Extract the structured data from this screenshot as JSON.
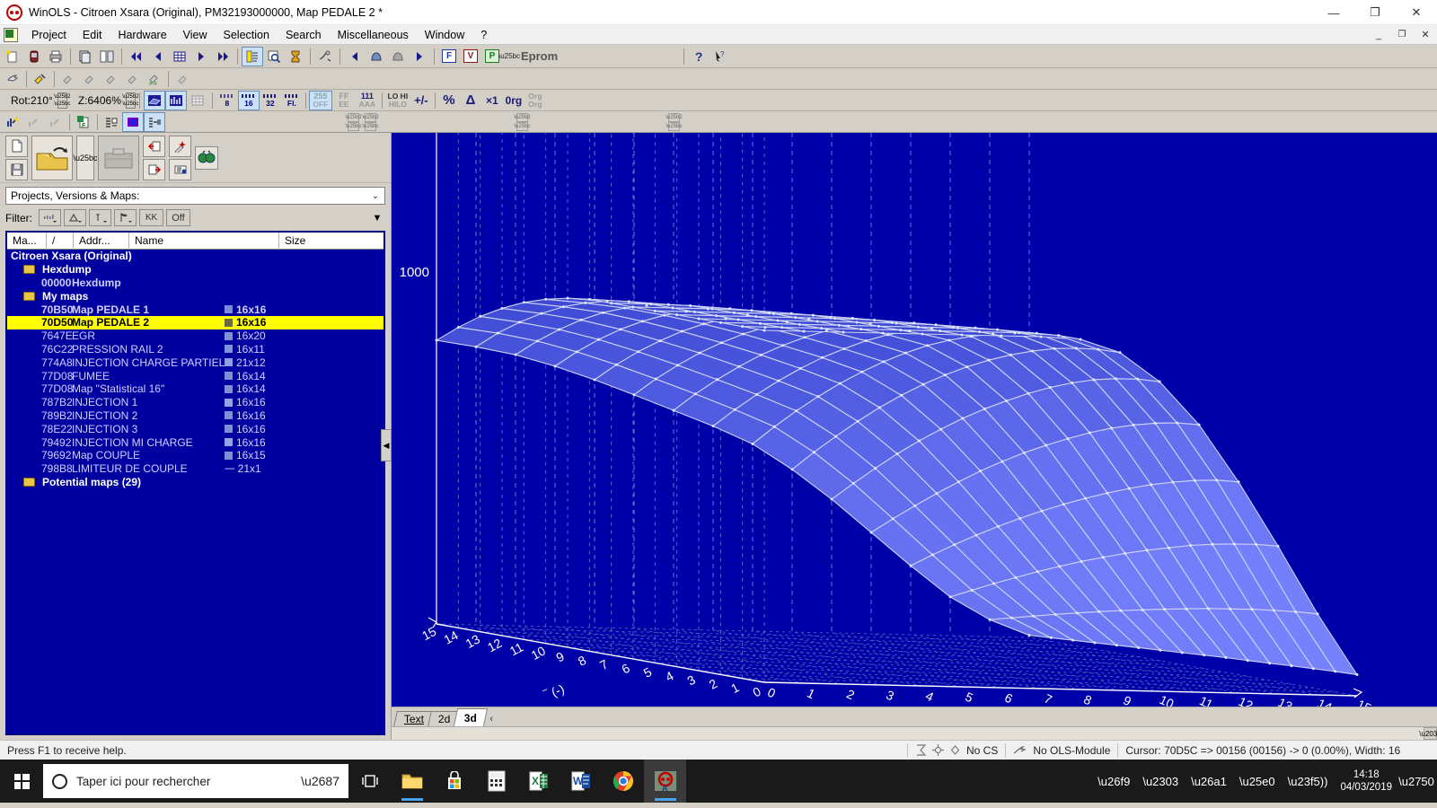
{
  "window": {
    "title": "WinOLS - Citroen Xsara (Original), PM32193000000, Map PEDALE 2 *",
    "minimize": "—",
    "maximize": "❐",
    "close": "✕",
    "inner_minimize": "_",
    "inner_restore": "❐",
    "inner_close": "✕"
  },
  "menu": {
    "items": [
      {
        "label": "Project"
      },
      {
        "label": "Edit"
      },
      {
        "label": "Hardware"
      },
      {
        "label": "View"
      },
      {
        "label": "Selection"
      },
      {
        "label": "Search"
      },
      {
        "label": "Miscellaneous"
      },
      {
        "label": "Window"
      },
      {
        "label": "?"
      }
    ]
  },
  "toolbar_main": {
    "eprom_label": "Eprom",
    "mode_f": "F",
    "mode_v": "V",
    "mode_p": "P",
    "help": "?",
    "help_arrow": "❇"
  },
  "toolbar_view": {
    "rotation": "Rot:210°",
    "zoom": "Z:6406%",
    "bits": [
      "8",
      "16",
      "32",
      "Fl."
    ],
    "bits_selected": "16",
    "values": [
      "255",
      "FF",
      "111"
    ],
    "values_sub": [
      "OFF",
      "EE",
      "AAA"
    ],
    "values_selected": "255",
    "hilo_top": "LO HI",
    "hilo_bottom": "HILO",
    "plusminus": "+/-",
    "percent": "%",
    "delta": "Δ",
    "times1": "×1",
    "org": "0rg",
    "orgorg_top": "Org",
    "orgorg_bottom": "Org"
  },
  "left_panel": {
    "combo": {
      "value": "Projects, Versions & Maps:",
      "chevron": "⌄"
    },
    "filter": {
      "label": "Filter:",
      "buttons": [
        "▒",
        "Δ",
        "i̅",
        "⚑",
        "KK"
      ],
      "off_label": "Off",
      "dropdown": "▼"
    },
    "columns": [
      "Ma...",
      "/",
      "Addr...",
      "Name",
      "Size"
    ],
    "rows": [
      {
        "type": "root",
        "name": "Citroen Xsara (Original)"
      },
      {
        "type": "folder",
        "name": "Hexdump"
      },
      {
        "type": "item",
        "addr": "00000",
        "name": "Hexdump",
        "size": "",
        "bold": true,
        "chip": ""
      },
      {
        "type": "folder",
        "name": "My maps"
      },
      {
        "type": "item",
        "addr": "70B50",
        "name": "Map PEDALE 1",
        "size": "16x16",
        "bold": true,
        "chip": "#7a8ce0"
      },
      {
        "type": "item",
        "addr": "70D50",
        "name": "Map PEDALE 2",
        "size": "16x16",
        "bold": true,
        "highlight": true,
        "chip": "#6a6a3a"
      },
      {
        "type": "item",
        "addr": "7647E",
        "name": "EGR",
        "size": "16x20",
        "chip": "#8090d8"
      },
      {
        "type": "item",
        "addr": "76C22",
        "name": "PRESSION RAIL 2",
        "size": "16x11",
        "chip": "#7f93dd"
      },
      {
        "type": "item",
        "addr": "774A8",
        "name": "INJECTION CHARGE PARTIEL1",
        "size": "21x12",
        "chip": "#8fa0e4"
      },
      {
        "type": "item",
        "addr": "77D08",
        "name": "FUMEE",
        "size": "16x14",
        "chip": "#8090d8"
      },
      {
        "type": "item",
        "addr": "77D08",
        "name": "Map \"Statistical 16\"",
        "size": "16x14",
        "chip": "#8090d8"
      },
      {
        "type": "item",
        "addr": "787B2",
        "name": "INJECTION 1",
        "size": "16x16",
        "chip": "#93a3e8"
      },
      {
        "type": "item",
        "addr": "789B2",
        "name": "INJECTION 2",
        "size": "16x16",
        "chip": "#8090d8"
      },
      {
        "type": "item",
        "addr": "78E22",
        "name": "INJECTION 3",
        "size": "16x16",
        "chip": "#8090d8"
      },
      {
        "type": "item",
        "addr": "79492",
        "name": "INJECTION MI CHARGE",
        "size": "16x16",
        "chip": "#93a3e8"
      },
      {
        "type": "item",
        "addr": "79692",
        "name": "Map COUPLE",
        "size": "16x15",
        "chip": "#8090d8"
      },
      {
        "type": "item",
        "addr": "798B8",
        "name": "LIMITEUR DE COUPLE",
        "size": "21x1",
        "chip": "dashes"
      },
      {
        "type": "folder",
        "name": "Potential maps (29)"
      }
    ],
    "splitter": "◀"
  },
  "view_tabs": {
    "items": [
      {
        "label": "Text",
        "active": false
      },
      {
        "label": "2d",
        "active": false
      },
      {
        "label": "3d",
        "active": true
      }
    ],
    "scroll_left": "‹"
  },
  "statusbar": {
    "hint": "Press F1 to receive help.",
    "checksum": "No CS",
    "module": "No OLS-Module",
    "cursor": "Cursor: 70D5C => 00156 (00156) -> 0 (0.00%), Width: 16"
  },
  "taskbar": {
    "search_placeholder": "Taper ici pour rechercher",
    "time": "14:18",
    "date": "04/03/2019",
    "apps": [
      {
        "name": "task-view"
      },
      {
        "name": "file-explorer"
      },
      {
        "name": "microsoft-store"
      },
      {
        "name": "calculator"
      },
      {
        "name": "excel"
      },
      {
        "name": "word"
      },
      {
        "name": "chrome"
      },
      {
        "name": "winols",
        "active": true
      }
    ]
  },
  "chart_data": {
    "type": "surface",
    "title": "Map PEDALE 2",
    "xlabel": "(-)",
    "ylabel": "(-)",
    "zlabel": "1000",
    "x_ticks": [
      0,
      1,
      2,
      3,
      4,
      5,
      6,
      7,
      8,
      9,
      10,
      11,
      12,
      13,
      14,
      15
    ],
    "y_ticks": [
      0,
      1,
      2,
      3,
      4,
      5,
      6,
      7,
      8,
      9,
      10,
      11,
      12,
      13,
      14,
      15
    ],
    "z_ticks": [
      1000
    ],
    "grid": true,
    "rotation_deg": 210,
    "zoom_percent": 6406,
    "rows": 16,
    "cols": 16,
    "surface_color": "#4a57cf",
    "background_color": "#0000a8",
    "mesh_color": "#ccd2f5",
    "values": [
      [
        1000,
        1000,
        1000,
        1000,
        1000,
        1000,
        1000,
        1000,
        995,
        960,
        880,
        760,
        600,
        420,
        230,
        60
      ],
      [
        1000,
        1000,
        1000,
        1000,
        1000,
        1000,
        1000,
        1000,
        995,
        958,
        876,
        754,
        594,
        414,
        225,
        58
      ],
      [
        1000,
        1000,
        1000,
        1000,
        1000,
        1000,
        1000,
        998,
        990,
        950,
        866,
        742,
        582,
        404,
        218,
        55
      ],
      [
        1000,
        1000,
        1000,
        1000,
        1000,
        1000,
        998,
        992,
        980,
        938,
        852,
        726,
        566,
        392,
        210,
        52
      ],
      [
        1000,
        1000,
        1000,
        1000,
        1000,
        998,
        992,
        982,
        966,
        920,
        832,
        706,
        548,
        378,
        200,
        48
      ],
      [
        1000,
        1000,
        1000,
        1000,
        998,
        992,
        982,
        968,
        948,
        898,
        808,
        682,
        526,
        360,
        190,
        45
      ],
      [
        1000,
        1000,
        1000,
        998,
        992,
        982,
        968,
        950,
        926,
        872,
        780,
        654,
        502,
        342,
        178,
        42
      ],
      [
        1000,
        1000,
        998,
        992,
        982,
        968,
        950,
        928,
        900,
        842,
        748,
        624,
        476,
        322,
        166,
        38
      ],
      [
        1000,
        996,
        990,
        980,
        966,
        948,
        926,
        900,
        868,
        808,
        714,
        592,
        448,
        300,
        153,
        34
      ],
      [
        992,
        986,
        976,
        962,
        944,
        922,
        896,
        866,
        832,
        770,
        676,
        556,
        418,
        277,
        140,
        30
      ],
      [
        978,
        970,
        958,
        940,
        918,
        892,
        862,
        830,
        792,
        728,
        634,
        518,
        386,
        252,
        126,
        26
      ],
      [
        958,
        948,
        934,
        912,
        886,
        856,
        824,
        788,
        748,
        682,
        590,
        476,
        352,
        226,
        111,
        22
      ],
      [
        930,
        918,
        902,
        878,
        848,
        816,
        780,
        742,
        700,
        632,
        542,
        432,
        316,
        198,
        96,
        18
      ],
      [
        896,
        882,
        864,
        838,
        806,
        770,
        732,
        692,
        648,
        578,
        490,
        386,
        278,
        170,
        80,
        14
      ],
      [
        854,
        840,
        820,
        792,
        758,
        720,
        680,
        638,
        592,
        522,
        436,
        338,
        238,
        140,
        64,
        10
      ],
      [
        806,
        790,
        770,
        740,
        704,
        664,
        622,
        580,
        532,
        462,
        380,
        288,
        196,
        110,
        48,
        6
      ]
    ]
  }
}
